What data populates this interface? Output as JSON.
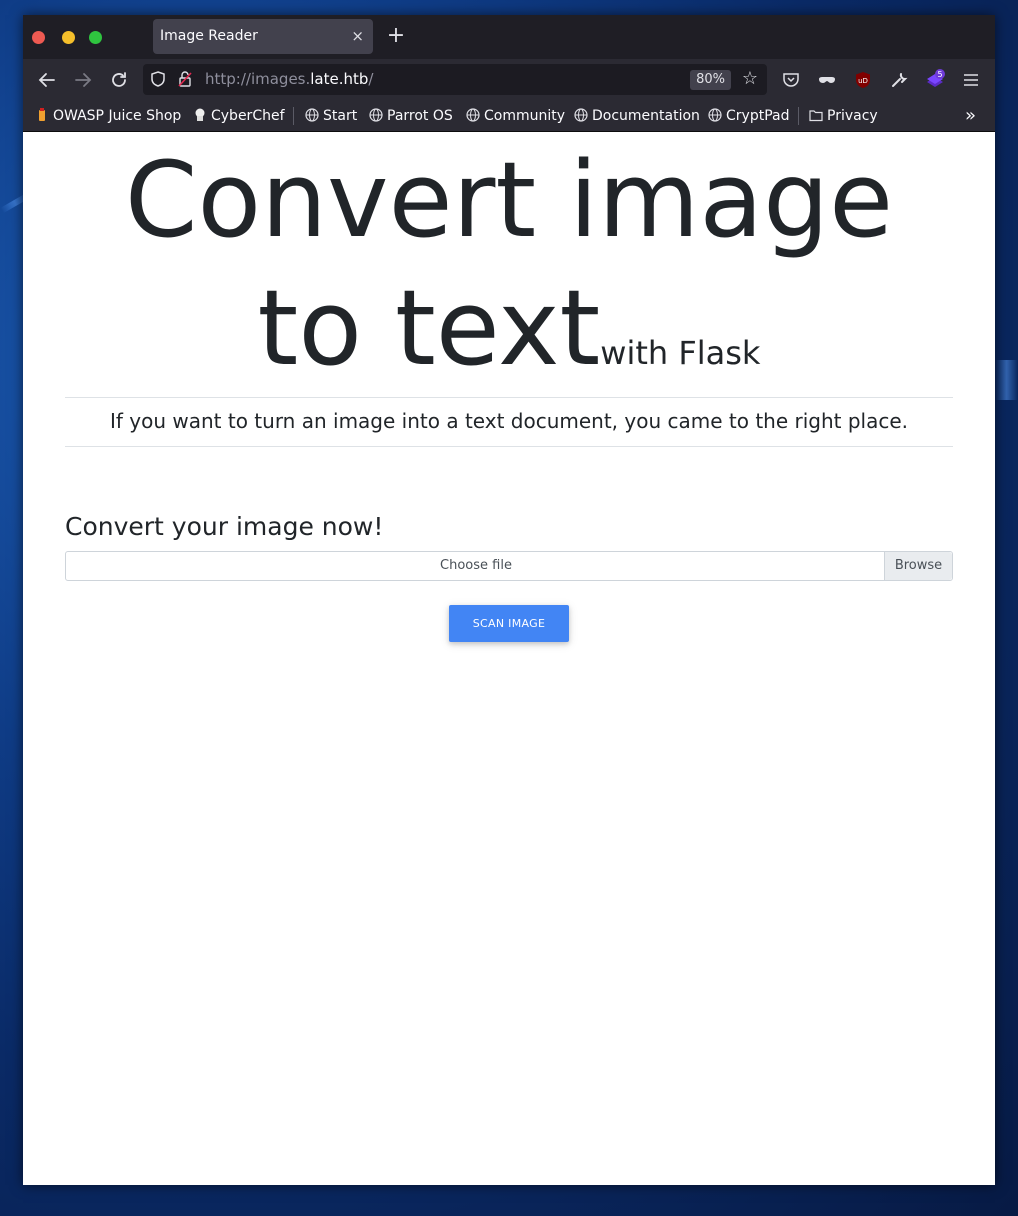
{
  "browser": {
    "tab_title": "Image Reader",
    "tab_close": "×",
    "new_tab": "+",
    "url_scheme": "http://images.",
    "url_host": "late.htb",
    "url_path": "/",
    "zoom": "80%",
    "extension_badge": "5",
    "ublock_label": "uD"
  },
  "bookmarks": [
    {
      "label": "OWASP Juice Shop",
      "icon": "juice-icon"
    },
    {
      "label": "CyberChef",
      "icon": "chef-icon"
    },
    {
      "label": "Start",
      "icon": "globe-icon"
    },
    {
      "label": "Parrot OS",
      "icon": "globe-icon"
    },
    {
      "label": "Community",
      "icon": "globe-icon"
    },
    {
      "label": "Documentation",
      "icon": "globe-icon"
    },
    {
      "label": "CryptPad",
      "icon": "globe-icon"
    },
    {
      "label": "Privacy",
      "icon": "folder-icon"
    }
  ],
  "overflow": "»",
  "page": {
    "title_line1": "Convert image",
    "title_line2": "to text",
    "title_small": "with Flask",
    "lead": "If you want to turn an image into a text document, you came to the right place.",
    "form_title": "Convert your image now!",
    "file_placeholder": "Choose file",
    "browse_label": "Browse",
    "scan_label": "SCAN IMAGE"
  },
  "colors": {
    "primary_button": "#4285f4",
    "text": "#212529",
    "chrome_dark": "#2b2a33"
  }
}
